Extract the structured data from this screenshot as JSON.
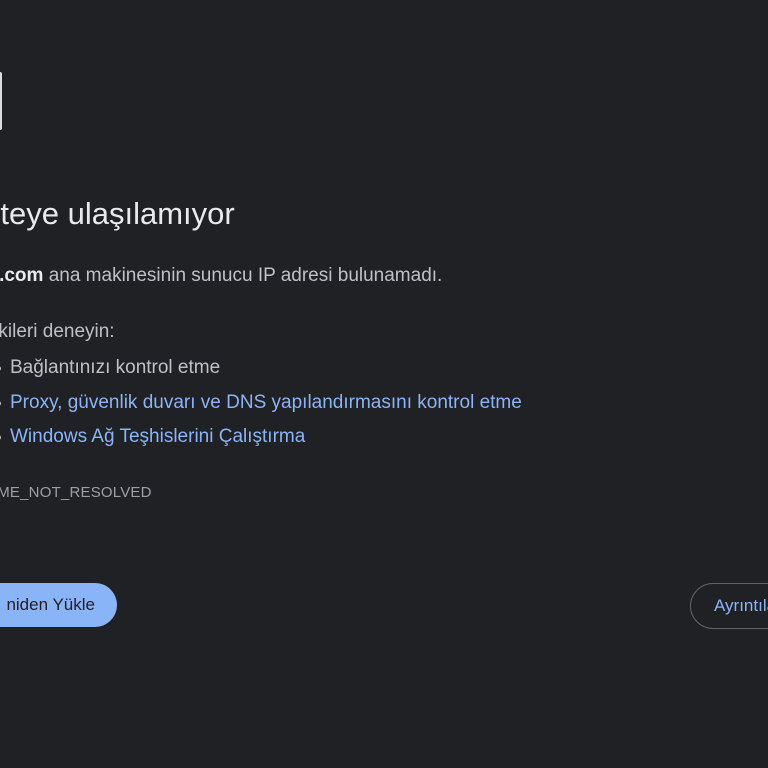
{
  "error_page": {
    "title": "siteye ulaşılamıyor",
    "description": {
      "host": "xum.com",
      "message": "ana makinesinin sunucu IP adresi bulunamadı."
    },
    "try_label": "ıdakileri deneyin:",
    "suggestions": [
      {
        "label": "Bağlantınızı kontrol etme",
        "is_link": false
      },
      {
        "label": "Proxy, güvenlik duvarı ve DNS yapılandırmasını kontrol etme",
        "is_link": true
      },
      {
        "label": "Windows Ağ Teşhislerini Çalıştırma",
        "is_link": true
      }
    ],
    "error_code": "NAME_NOT_RESOLVED",
    "reload_button": "niden Yükle",
    "details_button": "Ayrıntılar"
  },
  "colors": {
    "background": "#202124",
    "title": "#e8eaed",
    "text": "#bdc1c6",
    "link": "#8ab4f8",
    "button_primary": "#8ab4f8"
  },
  "icons": {
    "error": "sad-page-icon"
  }
}
